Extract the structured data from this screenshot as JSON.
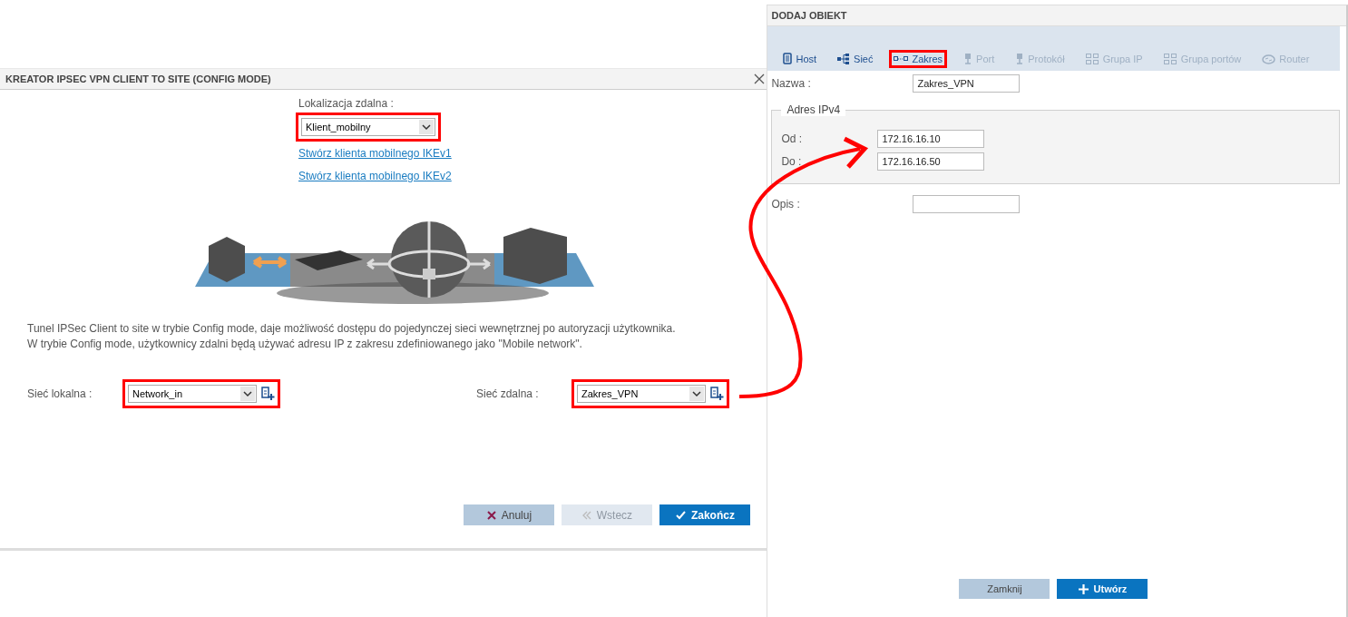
{
  "wizard": {
    "title": "KREATOR IPSEC VPN CLIENT TO SITE (CONFIG MODE)",
    "remote_location": {
      "label": "Lokalizacja zdalna :",
      "value": "Klient_mobilny",
      "highlighted": true
    },
    "links": [
      "Stwórz klienta mobilnego IKEv1",
      "Stwórz klienta mobilnego IKEv2"
    ],
    "description": [
      "Tunel IPSec Client to site w trybie Config mode, daje możliwość dostępu do pojedynczej sieci wewnętrznej po autoryzacji użytkownika.",
      "W trybie Config mode, użytkownicy zdalni będą używać adresu IP z zakresu zdefiniowanego jako \"Mobile network\"."
    ],
    "networks": [
      {
        "label": "Sieć lokalna :",
        "value": "Network_in",
        "highlighted": true
      },
      {
        "label": "Sieć zdalna :",
        "value": "Zakres_VPN",
        "highlighted": true
      }
    ],
    "buttons": [
      {
        "label": "Anuluj",
        "kind": "cancel",
        "disabled": false
      },
      {
        "label": "Wstecz",
        "kind": "back",
        "disabled": true
      },
      {
        "label": "Zakończ",
        "kind": "finish",
        "disabled": false
      }
    ]
  },
  "add_object": {
    "title": "DODAJ OBIEKT",
    "tabs": [
      {
        "label": "Host",
        "kind": "host",
        "selected": false,
        "disabled": false
      },
      {
        "label": "Sieć",
        "kind": "network",
        "selected": false,
        "disabled": false
      },
      {
        "label": "Zakres",
        "kind": "range",
        "selected": true,
        "disabled": false
      },
      {
        "label": "Port",
        "kind": "port",
        "selected": false,
        "disabled": true
      },
      {
        "label": "Protokół",
        "kind": "protocol",
        "selected": false,
        "disabled": true
      },
      {
        "label": "Grupa IP",
        "kind": "ip-group",
        "selected": false,
        "disabled": true
      },
      {
        "label": "Grupa portów",
        "kind": "port-group",
        "selected": false,
        "disabled": true
      },
      {
        "label": "Router",
        "kind": "router",
        "selected": false,
        "disabled": true
      }
    ],
    "name": {
      "label": "Nazwa :",
      "value": "Zakres_VPN"
    },
    "ipv4": {
      "title": "Adres IPv4",
      "from": {
        "label": "Od :",
        "value": "172.16.16.10"
      },
      "to": {
        "label": "Do :",
        "value": "172.16.16.50"
      }
    },
    "description": {
      "label": "Opis :"
    },
    "buttons": [
      {
        "label": "Zamknij",
        "kind": "close"
      },
      {
        "label": "Utwórz",
        "kind": "create"
      }
    ]
  }
}
